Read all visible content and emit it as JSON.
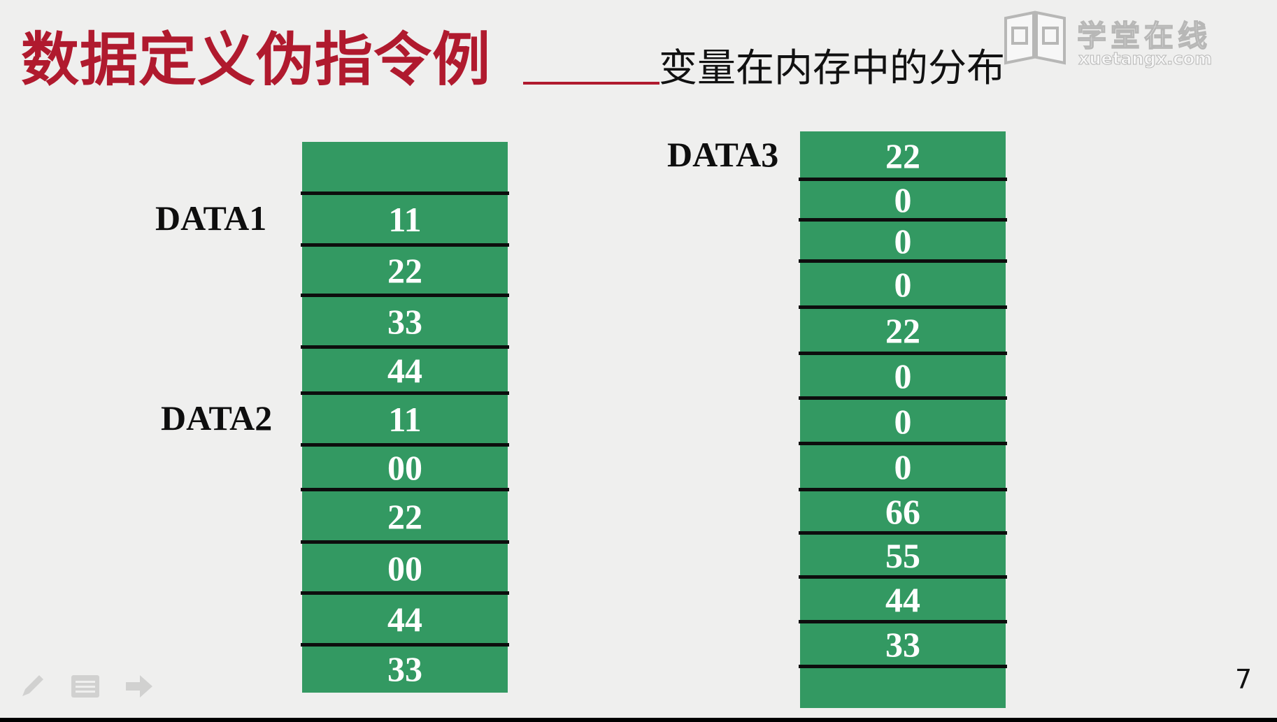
{
  "slide": {
    "title_main": "数据定义伪指令例",
    "title_sub": "变量在内存中的分布",
    "page_number": "7"
  },
  "watermark": {
    "text": "学堂在线",
    "url": "xuetangx.com"
  },
  "memory_left": {
    "cells": [
      "",
      "11",
      "22",
      "33",
      "44",
      "11",
      "00",
      "22",
      "00",
      "44",
      "33"
    ],
    "labels": [
      {
        "text": "DATA1",
        "cell_index": 1
      },
      {
        "text": "DATA2",
        "cell_index": 5
      }
    ]
  },
  "memory_right": {
    "cells": [
      "22",
      "0",
      "0",
      "0",
      "22",
      "0",
      "0",
      "0",
      "66",
      "55",
      "44",
      "33",
      ""
    ],
    "labels": [
      {
        "text": "DATA3",
        "cell_index": 0
      }
    ]
  },
  "colors": {
    "title_red": "#b01a2e",
    "cell_green": "#339962",
    "cell_text": "#ffffff",
    "separator": "#0d0d0d",
    "background": "#efefee"
  },
  "icons": [
    "pen-icon",
    "menu-icon",
    "arrow-right-icon"
  ]
}
